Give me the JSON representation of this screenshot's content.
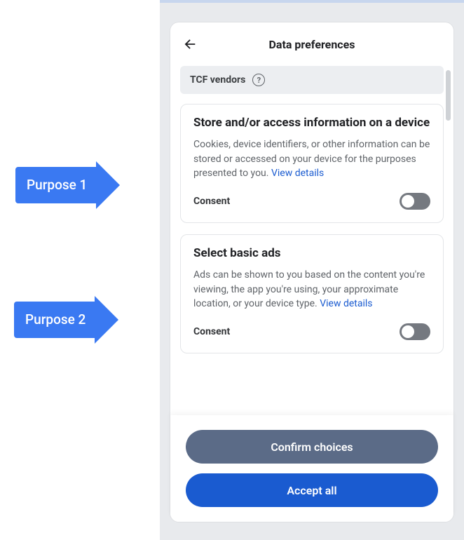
{
  "callouts": {
    "purpose1": "Purpose 1",
    "purpose2": "Purpose 2"
  },
  "modal": {
    "title": "Data preferences",
    "tcf_label": "TCF vendors",
    "cards": [
      {
        "title": "Store and/or access information on a device",
        "body": "Cookies, device identifiers, or other information can be stored or accessed on your device for the purposes presented to you. ",
        "view_details": "View details",
        "consent_label": "Consent"
      },
      {
        "title": "Select basic ads",
        "body": "Ads can be shown to you based on the content you're viewing, the app you're using, your approximate location, or your device type. ",
        "view_details": "View details",
        "consent_label": "Consent"
      }
    ],
    "buttons": {
      "confirm": "Confirm choices",
      "accept": "Accept all"
    }
  }
}
